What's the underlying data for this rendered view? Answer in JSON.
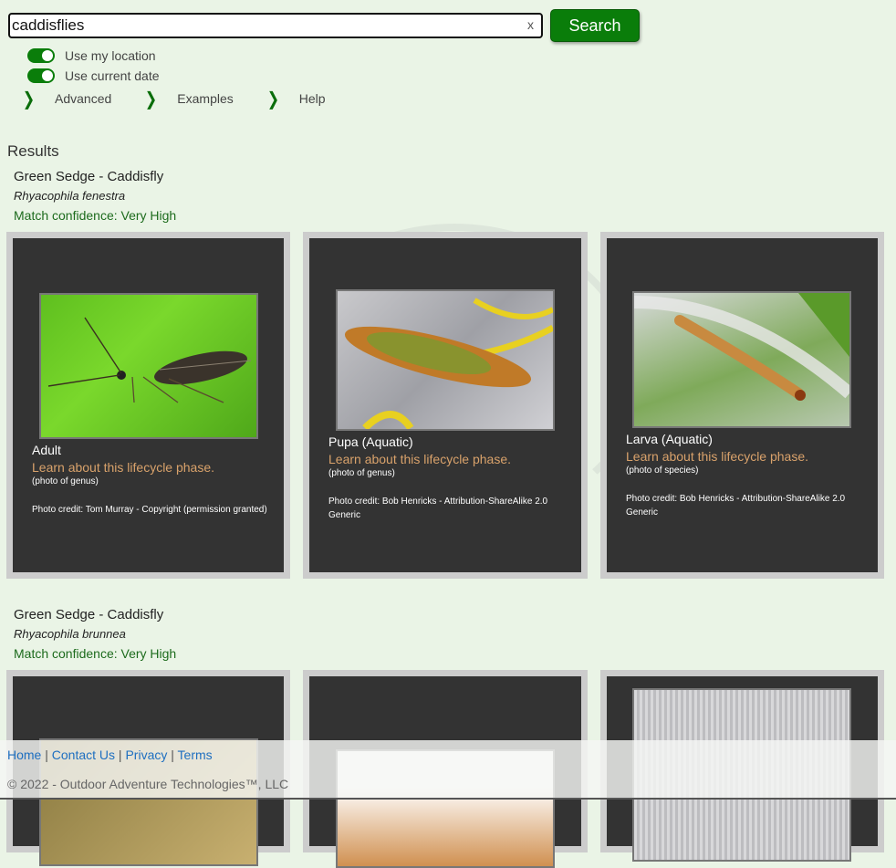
{
  "search": {
    "value": "caddisflies",
    "clear_label": "x",
    "button_label": "Search"
  },
  "options": {
    "use_location": {
      "label": "Use my location",
      "on": true
    },
    "use_date": {
      "label": "Use current date",
      "on": true
    }
  },
  "nav": [
    {
      "label": "Advanced",
      "icon": "chevron-right-icon"
    },
    {
      "label": "Examples",
      "icon": "chevron-right-icon"
    },
    {
      "label": "Help",
      "icon": "chevron-right-icon"
    }
  ],
  "results_title": "Results",
  "results": [
    {
      "common_name": "Green Sedge - Caddisfly",
      "scientific_name": "Rhyacophila fenestra",
      "confidence": "Match confidence: Very High",
      "cards": [
        {
          "phase": "Adult",
          "learn": "Learn about this lifecycle phase.",
          "photo_of": "(photo of genus)",
          "credit": "Photo credit: Tom Murray - Copyright (permission granted)"
        },
        {
          "phase": "Pupa (Aquatic)",
          "learn": "Learn about this lifecycle phase.",
          "photo_of": "(photo of genus)",
          "credit": "Photo credit: Bob Henricks - Attribution-ShareAlike 2.0 Generic"
        },
        {
          "phase": "Larva (Aquatic)",
          "learn": "Learn about this lifecycle phase.",
          "photo_of": "(photo of species)",
          "credit": "Photo credit: Bob Henricks - Attribution-ShareAlike 2.0 Generic"
        }
      ]
    },
    {
      "common_name": "Green Sedge - Caddisfly",
      "scientific_name": "Rhyacophila brunnea",
      "confidence": "Match confidence: Very High"
    }
  ],
  "footer": {
    "links": [
      "Home",
      "Contact Us",
      "Privacy",
      "Terms"
    ],
    "separator": "|",
    "copyright": "© 2022 - Outdoor Adventure Technologies™, LLC"
  },
  "colors": {
    "accent": "#0a7d0a",
    "background": "#eaf4e6",
    "card_border": "#cccccc",
    "card_bg": "#333333",
    "learn_link": "#d9a26b",
    "confidence": "#1d6b1d",
    "footer_link": "#1e6fc0"
  }
}
